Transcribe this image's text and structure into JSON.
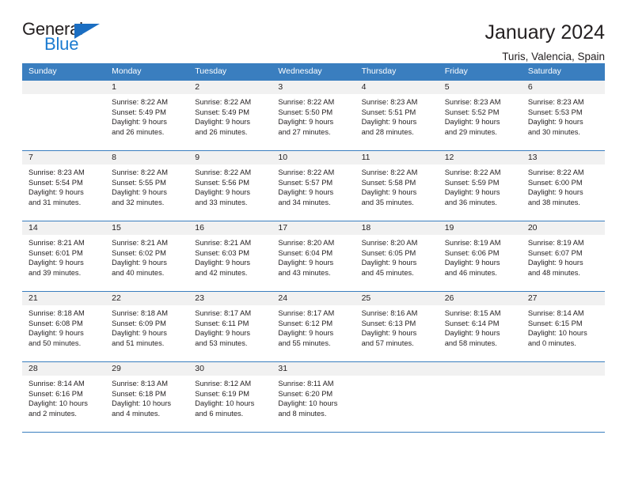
{
  "logo": {
    "word_top": "General",
    "word_bottom": "Blue",
    "triangle_icon": "triangle-icon",
    "accent_color": "#1b6ec2"
  },
  "header": {
    "title": "January 2024",
    "subtitle": "Turis, Valencia, Spain"
  },
  "calendar": {
    "header_color": "#3a7ebf",
    "weekdays": [
      "Sunday",
      "Monday",
      "Tuesday",
      "Wednesday",
      "Thursday",
      "Friday",
      "Saturday"
    ],
    "weeks": [
      [
        {
          "day": "",
          "lines": []
        },
        {
          "day": "1",
          "lines": [
            "Sunrise: 8:22 AM",
            "Sunset: 5:49 PM",
            "Daylight: 9 hours",
            "and 26 minutes."
          ]
        },
        {
          "day": "2",
          "lines": [
            "Sunrise: 8:22 AM",
            "Sunset: 5:49 PM",
            "Daylight: 9 hours",
            "and 26 minutes."
          ]
        },
        {
          "day": "3",
          "lines": [
            "Sunrise: 8:22 AM",
            "Sunset: 5:50 PM",
            "Daylight: 9 hours",
            "and 27 minutes."
          ]
        },
        {
          "day": "4",
          "lines": [
            "Sunrise: 8:23 AM",
            "Sunset: 5:51 PM",
            "Daylight: 9 hours",
            "and 28 minutes."
          ]
        },
        {
          "day": "5",
          "lines": [
            "Sunrise: 8:23 AM",
            "Sunset: 5:52 PM",
            "Daylight: 9 hours",
            "and 29 minutes."
          ]
        },
        {
          "day": "6",
          "lines": [
            "Sunrise: 8:23 AM",
            "Sunset: 5:53 PM",
            "Daylight: 9 hours",
            "and 30 minutes."
          ]
        }
      ],
      [
        {
          "day": "7",
          "lines": [
            "Sunrise: 8:23 AM",
            "Sunset: 5:54 PM",
            "Daylight: 9 hours",
            "and 31 minutes."
          ]
        },
        {
          "day": "8",
          "lines": [
            "Sunrise: 8:22 AM",
            "Sunset: 5:55 PM",
            "Daylight: 9 hours",
            "and 32 minutes."
          ]
        },
        {
          "day": "9",
          "lines": [
            "Sunrise: 8:22 AM",
            "Sunset: 5:56 PM",
            "Daylight: 9 hours",
            "and 33 minutes."
          ]
        },
        {
          "day": "10",
          "lines": [
            "Sunrise: 8:22 AM",
            "Sunset: 5:57 PM",
            "Daylight: 9 hours",
            "and 34 minutes."
          ]
        },
        {
          "day": "11",
          "lines": [
            "Sunrise: 8:22 AM",
            "Sunset: 5:58 PM",
            "Daylight: 9 hours",
            "and 35 minutes."
          ]
        },
        {
          "day": "12",
          "lines": [
            "Sunrise: 8:22 AM",
            "Sunset: 5:59 PM",
            "Daylight: 9 hours",
            "and 36 minutes."
          ]
        },
        {
          "day": "13",
          "lines": [
            "Sunrise: 8:22 AM",
            "Sunset: 6:00 PM",
            "Daylight: 9 hours",
            "and 38 minutes."
          ]
        }
      ],
      [
        {
          "day": "14",
          "lines": [
            "Sunrise: 8:21 AM",
            "Sunset: 6:01 PM",
            "Daylight: 9 hours",
            "and 39 minutes."
          ]
        },
        {
          "day": "15",
          "lines": [
            "Sunrise: 8:21 AM",
            "Sunset: 6:02 PM",
            "Daylight: 9 hours",
            "and 40 minutes."
          ]
        },
        {
          "day": "16",
          "lines": [
            "Sunrise: 8:21 AM",
            "Sunset: 6:03 PM",
            "Daylight: 9 hours",
            "and 42 minutes."
          ]
        },
        {
          "day": "17",
          "lines": [
            "Sunrise: 8:20 AM",
            "Sunset: 6:04 PM",
            "Daylight: 9 hours",
            "and 43 minutes."
          ]
        },
        {
          "day": "18",
          "lines": [
            "Sunrise: 8:20 AM",
            "Sunset: 6:05 PM",
            "Daylight: 9 hours",
            "and 45 minutes."
          ]
        },
        {
          "day": "19",
          "lines": [
            "Sunrise: 8:19 AM",
            "Sunset: 6:06 PM",
            "Daylight: 9 hours",
            "and 46 minutes."
          ]
        },
        {
          "day": "20",
          "lines": [
            "Sunrise: 8:19 AM",
            "Sunset: 6:07 PM",
            "Daylight: 9 hours",
            "and 48 minutes."
          ]
        }
      ],
      [
        {
          "day": "21",
          "lines": [
            "Sunrise: 8:18 AM",
            "Sunset: 6:08 PM",
            "Daylight: 9 hours",
            "and 50 minutes."
          ]
        },
        {
          "day": "22",
          "lines": [
            "Sunrise: 8:18 AM",
            "Sunset: 6:09 PM",
            "Daylight: 9 hours",
            "and 51 minutes."
          ]
        },
        {
          "day": "23",
          "lines": [
            "Sunrise: 8:17 AM",
            "Sunset: 6:11 PM",
            "Daylight: 9 hours",
            "and 53 minutes."
          ]
        },
        {
          "day": "24",
          "lines": [
            "Sunrise: 8:17 AM",
            "Sunset: 6:12 PM",
            "Daylight: 9 hours",
            "and 55 minutes."
          ]
        },
        {
          "day": "25",
          "lines": [
            "Sunrise: 8:16 AM",
            "Sunset: 6:13 PM",
            "Daylight: 9 hours",
            "and 57 minutes."
          ]
        },
        {
          "day": "26",
          "lines": [
            "Sunrise: 8:15 AM",
            "Sunset: 6:14 PM",
            "Daylight: 9 hours",
            "and 58 minutes."
          ]
        },
        {
          "day": "27",
          "lines": [
            "Sunrise: 8:14 AM",
            "Sunset: 6:15 PM",
            "Daylight: 10 hours",
            "and 0 minutes."
          ]
        }
      ],
      [
        {
          "day": "28",
          "lines": [
            "Sunrise: 8:14 AM",
            "Sunset: 6:16 PM",
            "Daylight: 10 hours",
            "and 2 minutes."
          ]
        },
        {
          "day": "29",
          "lines": [
            "Sunrise: 8:13 AM",
            "Sunset: 6:18 PM",
            "Daylight: 10 hours",
            "and 4 minutes."
          ]
        },
        {
          "day": "30",
          "lines": [
            "Sunrise: 8:12 AM",
            "Sunset: 6:19 PM",
            "Daylight: 10 hours",
            "and 6 minutes."
          ]
        },
        {
          "day": "31",
          "lines": [
            "Sunrise: 8:11 AM",
            "Sunset: 6:20 PM",
            "Daylight: 10 hours",
            "and 8 minutes."
          ]
        },
        {
          "day": "",
          "lines": []
        },
        {
          "day": "",
          "lines": []
        },
        {
          "day": "",
          "lines": []
        }
      ]
    ]
  }
}
